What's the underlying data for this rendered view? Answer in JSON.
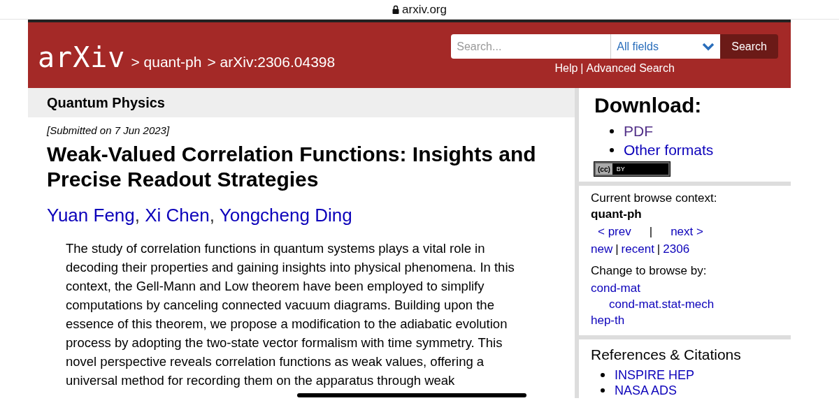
{
  "browser": {
    "address": "arxiv.org"
  },
  "header": {
    "logo": "arXiv",
    "breadcrumbs": [
      "quant-ph",
      "arXiv:2306.04398"
    ],
    "search": {
      "placeholder": "Search..."
    },
    "field_select": "All fields",
    "search_button": "Search",
    "links": [
      "Help",
      "Advanced Search"
    ],
    "crumb_sep": ">",
    "link_sep": "|"
  },
  "subject": "Quantum Physics",
  "submitted": "[Submitted on 7 Jun 2023]",
  "title": "Weak-Valued Correlation Functions: Insights and Precise Readout Strategies",
  "authors": [
    "Yuan Feng",
    "Xi Chen",
    "Yongcheng Ding"
  ],
  "author_sep": ",",
  "abstract_lines": [
    "The study of correlation functions in quantum systems plays a vital role in",
    "decoding their properties and gaining insights into physical phenomena. In this",
    "context, the Gell-Mann and Low theorem have been employed to simplify",
    "computations by canceling connected vacuum diagrams. Building upon the",
    "essence of this theorem, we propose a modification to the adiabatic evolution",
    "process by adopting the two-state vector formalism with time symmetry. This",
    "novel perspective reveals correlation functions as weak values, offering a",
    "universal method for recording them on the apparatus through weak"
  ],
  "download": {
    "heading": "Download:",
    "links": [
      {
        "label": "PDF",
        "visited": true
      },
      {
        "label": "Other formats",
        "visited": false
      }
    ],
    "license_mark": "(cc)",
    "license": "BY"
  },
  "browse": {
    "label": "Current browse context:",
    "context": "quant-ph",
    "prev": "< prev",
    "next": "next >",
    "sep": "|",
    "links": [
      "new",
      "recent",
      "2306"
    ],
    "change_label": "Change to browse by:",
    "categories": [
      {
        "label": "cond-mat",
        "children": [
          {
            "label": "cond-mat.stat-mech"
          }
        ]
      },
      {
        "label": "hep-th"
      }
    ]
  },
  "references": {
    "heading": "References & Citations",
    "links": [
      "INSPIRE HEP",
      "NASA ADS"
    ]
  }
}
